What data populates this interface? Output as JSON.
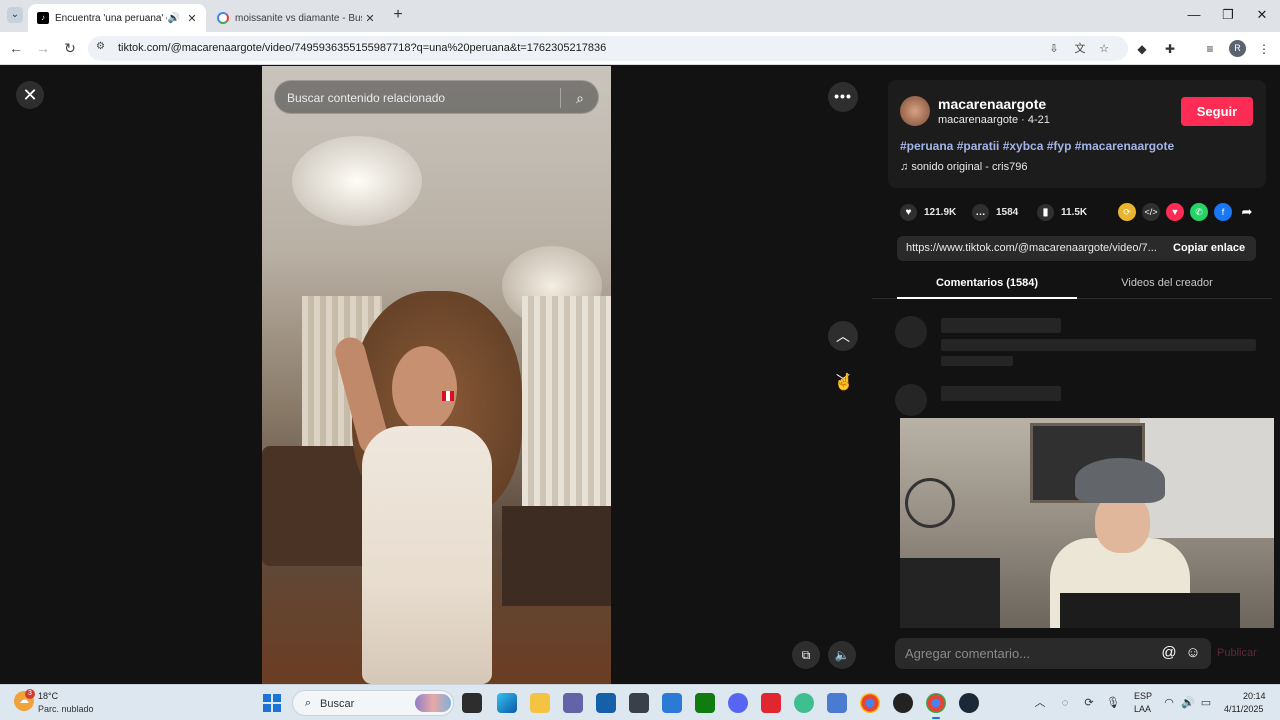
{
  "browser": {
    "tabs": [
      {
        "title": "Encuentra 'una peruana' en",
        "active": true
      },
      {
        "title": "moissanite vs diamante - Busca",
        "active": false
      }
    ],
    "new_tab_label": "+",
    "url": "tiktok.com/@macarenaargote/video/7495936355155987718?q=una%20peruana&t=1762305217836",
    "profile_initial": "R"
  },
  "video": {
    "search_placeholder": "Buscar contenido relacionado"
  },
  "author": {
    "display_name": "macarenaargote",
    "meta": "macarenaargote · 4-21",
    "follow_label": "Seguir",
    "hashtags": "#peruana #paratii #xybca #fyp #macarenaargote",
    "music": "sonido original - cris796"
  },
  "stats": {
    "likes": "121.9K",
    "comments": "1584",
    "saves": "11.5K"
  },
  "share": {
    "link": "https://www.tiktok.com/@macarenaargote/video/7...",
    "copy_label": "Copiar enlace"
  },
  "tabs": {
    "comments": "Comentarios (1584)",
    "creator_videos": "Videos del creador"
  },
  "comment_input": {
    "placeholder": "Agregar comentario...",
    "publish_label": "Publicar"
  },
  "taskbar": {
    "weather_temp": "18°C",
    "weather_desc": "Parc. nublado",
    "weather_badge": "3",
    "search_label": "Buscar",
    "lang_line1": "ESP",
    "lang_line2": "LAA",
    "time": "20:14",
    "date": "4/11/2025"
  },
  "colors": {
    "follow": "#fe2c55",
    "hashtag": "#a3b4e8",
    "page_bg": "#121212"
  }
}
